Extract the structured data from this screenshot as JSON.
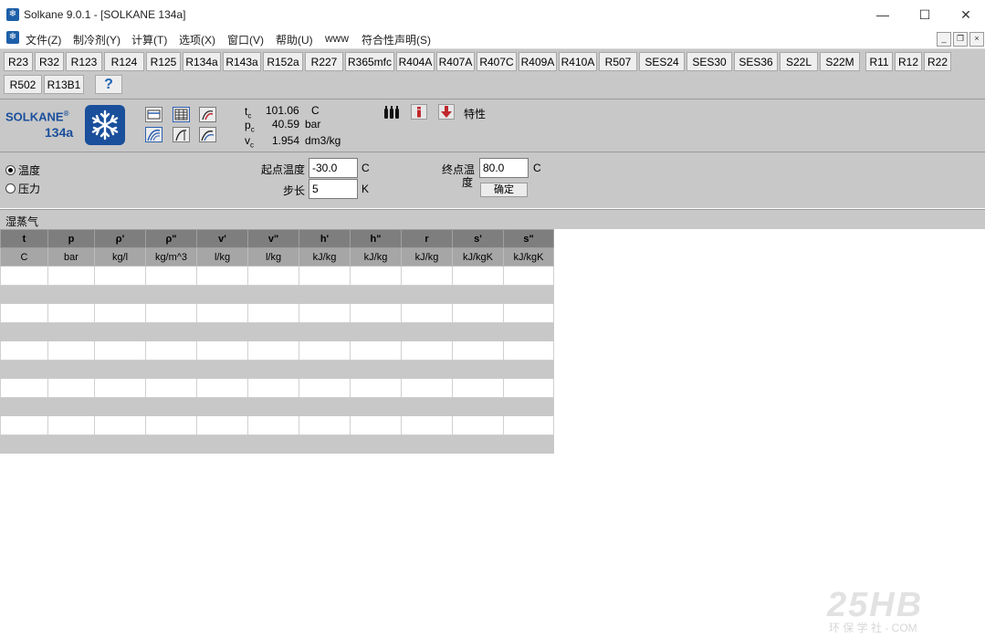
{
  "window": {
    "title": "Solkane 9.0.1 - [SOLKANE 134a]",
    "controls": {
      "minimize": "—",
      "maximize": "☐",
      "close": "✕"
    }
  },
  "menu": {
    "items": [
      "文件(Z)",
      "制冷剂(Y)",
      "计算(T)",
      "选项(X)",
      "窗口(V)",
      "帮助(U)",
      "www",
      "符合性声明(S)"
    ],
    "mdi_controls": {
      "minimize": "_",
      "restore": "❐",
      "close": "×"
    }
  },
  "refrigerants": {
    "row1": [
      "R23",
      "R32",
      "R123",
      "R124",
      "R125",
      "R134a",
      "R143a",
      "R152a",
      "R227",
      "R365mfc",
      "R404A",
      "R407A",
      "R407C",
      "R409A",
      "R410A",
      "R507",
      "SES24",
      "SES30",
      "SES36",
      "S22L",
      "S22M",
      "R11",
      "R12",
      "R22"
    ],
    "row2": [
      "R502",
      "R13B1"
    ],
    "help": "?"
  },
  "product": {
    "brand": "SOLKANE",
    "registered": "®",
    "name": "134a"
  },
  "critical": {
    "tc": {
      "symbol": "t",
      "sub": "c",
      "value": "101.06",
      "unit": "C"
    },
    "pc": {
      "symbol": "p",
      "sub": "c",
      "value": "40.59",
      "unit": "bar"
    },
    "vc": {
      "symbol": "v",
      "sub": "c",
      "value": "1.954",
      "unit": "dm3/kg"
    }
  },
  "properties": {
    "label": "特性"
  },
  "inputs": {
    "mode_temp": "温度",
    "mode_pressure": "压力",
    "start_label": "起点温度",
    "start_value": "-30.0",
    "start_unit": "C",
    "step_label": "步长",
    "step_value": "5",
    "step_unit": "K",
    "end_label_1": "终点温",
    "end_label_2": "度",
    "end_value": "80.0",
    "end_unit": "C",
    "confirm": "确定"
  },
  "section": {
    "title": "湿蒸气"
  },
  "table": {
    "headers": [
      "t",
      "p",
      "ρ'",
      "ρ\"",
      "v'",
      "v\"",
      "h'",
      "h\"",
      "r",
      "s'",
      "s\""
    ],
    "units": [
      "C",
      "bar",
      "kg/l",
      "kg/m^3",
      "l/kg",
      "l/kg",
      "kJ/kg",
      "kJ/kg",
      "kJ/kg",
      "kJ/kgK",
      "kJ/kgK"
    ],
    "empty_rows": 10
  }
}
